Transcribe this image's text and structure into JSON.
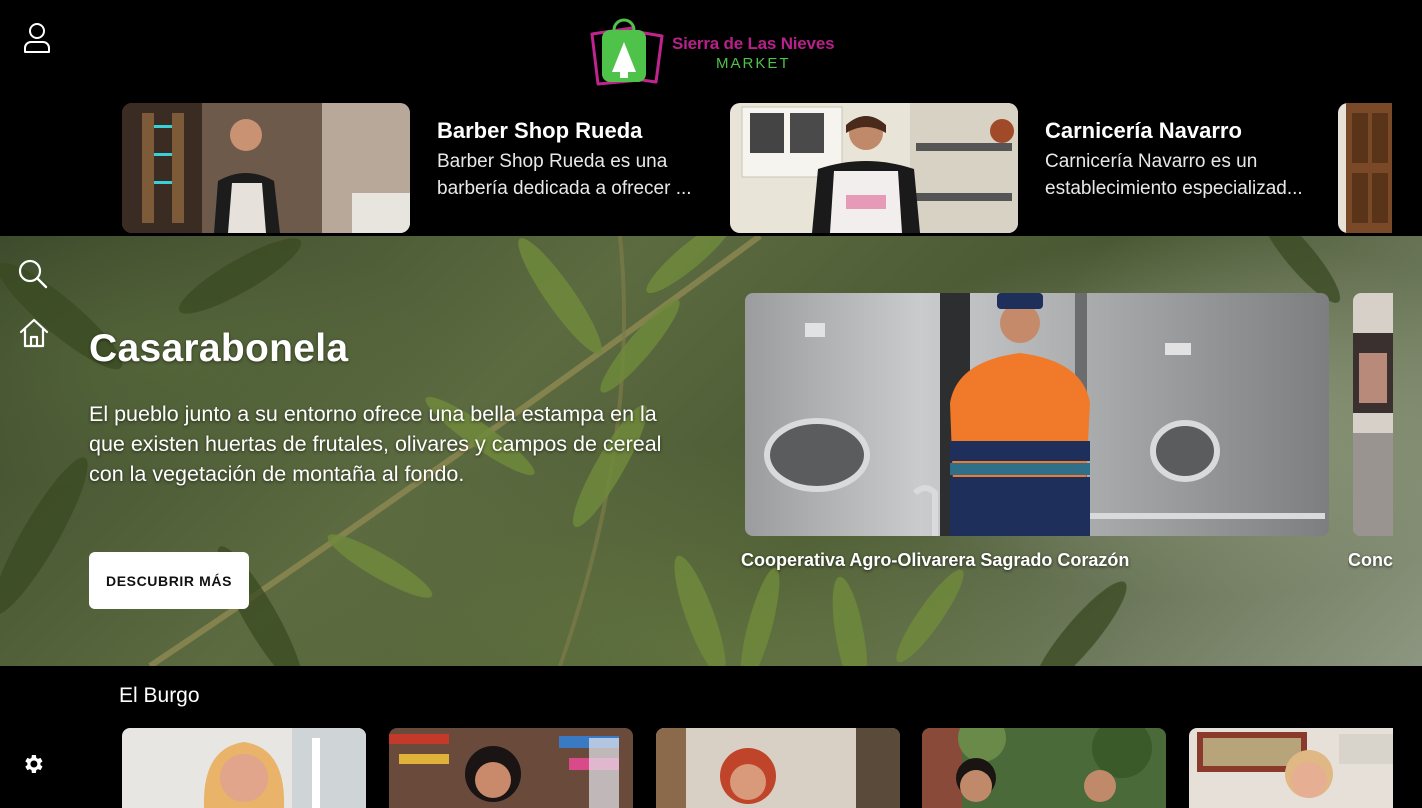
{
  "header": {
    "logo_title": "Sierra de Las Nieves",
    "logo_subtitle": "MARKET",
    "colors": {
      "brand_pink": "#b8208a",
      "brand_green": "#4fc24a"
    }
  },
  "top_carousel": [
    {
      "title": "Barber Shop Rueda",
      "desc_line1": " Barber Shop Rueda es una",
      "desc_line2": "barbería dedicada a ofrecer ..."
    },
    {
      "title": "Carnicería Navarro",
      "desc_line1": "Carnicería Navarro es un",
      "desc_line2": "establecimiento especializad..."
    }
  ],
  "hero": {
    "title": "Casarabonela",
    "description": "El pueblo junto a su entorno ofrece una bella estampa en la que existen huertas de frutales, olivares y campos de cereal con la vegetación de montaña al fondo.",
    "button_label": "DESCUBRIR MÁS",
    "feature_caption": "Cooperativa Agro-Olivarera Sagrado Corazón",
    "peek_caption": "Conc"
  },
  "bottom": {
    "section_title": "El Burgo"
  },
  "icons": [
    "user-icon",
    "search-icon",
    "home-icon",
    "settings-icon"
  ]
}
